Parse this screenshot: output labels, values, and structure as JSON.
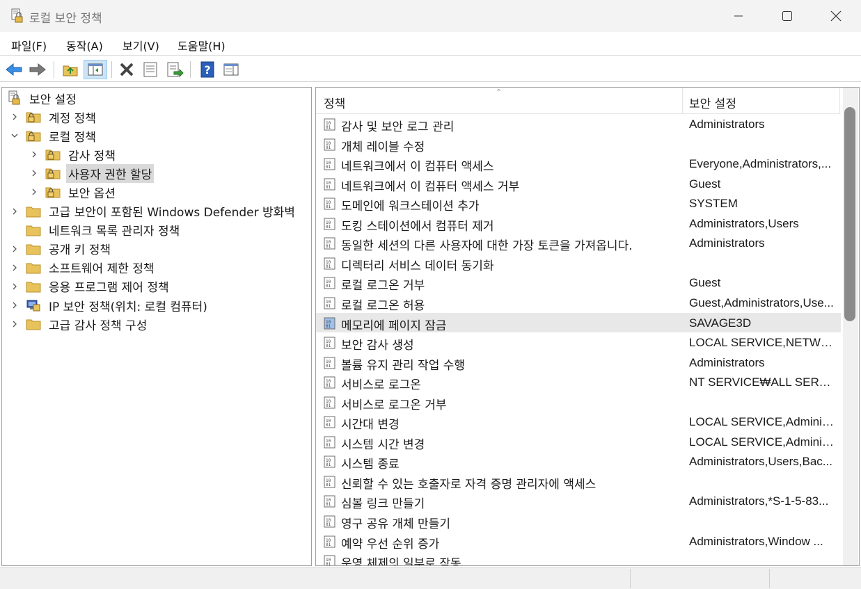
{
  "window": {
    "title": "로컬 보안 정책",
    "icon": "security-policy-icon"
  },
  "menu": {
    "items": [
      "파일(F)",
      "동작(A)",
      "보기(V)",
      "도움말(H)"
    ]
  },
  "toolbar": {
    "buttons": [
      "back-icon",
      "forward-icon",
      "up-folder-icon",
      "show-hide-tree-icon",
      "delete-icon",
      "properties-icon",
      "export-list-icon",
      "help-icon",
      "show-action-pane-icon"
    ]
  },
  "tree": {
    "root": "보안 설정",
    "items": [
      {
        "label": "계정 정책",
        "level": 1,
        "expanded": false
      },
      {
        "label": "로컬 정책",
        "level": 1,
        "expanded": true
      },
      {
        "label": "감사 정책",
        "level": 2,
        "expanded": false
      },
      {
        "label": "사용자 권한 할당",
        "level": 2,
        "expanded": false,
        "selected": true
      },
      {
        "label": "보안 옵션",
        "level": 2,
        "expanded": false
      },
      {
        "label": "고급 보안이 포함된 Windows Defender 방화벽",
        "level": 1,
        "expanded": false
      },
      {
        "label": "네트워크 목록 관리자 정책",
        "level": 1,
        "noexpand": true
      },
      {
        "label": "공개 키 정책",
        "level": 1,
        "expanded": false
      },
      {
        "label": "소프트웨어 제한 정책",
        "level": 1,
        "expanded": false
      },
      {
        "label": "응용 프로그램 제어 정책",
        "level": 1,
        "expanded": false
      },
      {
        "label": "IP 보안 정책(위치: 로컬 컴퓨터)",
        "level": 1,
        "expanded": false,
        "icon": "ip-security-icon"
      },
      {
        "label": "고급 감사 정책 구성",
        "level": 1,
        "expanded": false
      }
    ]
  },
  "list": {
    "columns": [
      "정책",
      "보안 설정"
    ],
    "rows": [
      {
        "policy": "감사 및 보안 로그 관리",
        "setting": "Administrators"
      },
      {
        "policy": "개체 레이블 수정",
        "setting": ""
      },
      {
        "policy": "네트워크에서 이 컴퓨터 액세스",
        "setting": "Everyone,Administrators,..."
      },
      {
        "policy": "네트워크에서 이 컴퓨터 액세스 거부",
        "setting": "Guest"
      },
      {
        "policy": "도메인에 워크스테이션 추가",
        "setting": "SYSTEM"
      },
      {
        "policy": "도킹 스테이션에서 컴퓨터 제거",
        "setting": "Administrators,Users"
      },
      {
        "policy": "동일한 세션의 다른 사용자에 대한 가장 토큰을 가져옵니다.",
        "setting": "Administrators"
      },
      {
        "policy": "디렉터리 서비스 데이터 동기화",
        "setting": ""
      },
      {
        "policy": "로컬 로그온 거부",
        "setting": "Guest"
      },
      {
        "policy": "로컬 로그온 허용",
        "setting": "Guest,Administrators,Use..."
      },
      {
        "policy": "메모리에 페이지 잠금",
        "setting": "SAVAGE3D",
        "selected": true
      },
      {
        "policy": "보안 감사 생성",
        "setting": "LOCAL SERVICE,NETWO..."
      },
      {
        "policy": "볼륨 유지 관리 작업 수행",
        "setting": "Administrators"
      },
      {
        "policy": "서비스로 로그온",
        "setting": "NT SERVICE₩ALL SERVIC..."
      },
      {
        "policy": "서비스로 로그온 거부",
        "setting": ""
      },
      {
        "policy": "시간대 변경",
        "setting": "LOCAL SERVICE,Adminis..."
      },
      {
        "policy": "시스템 시간 변경",
        "setting": "LOCAL SERVICE,Adminis..."
      },
      {
        "policy": "시스템 종료",
        "setting": "Administrators,Users,Bac..."
      },
      {
        "policy": "신뢰할 수 있는 호출자로 자격 증명 관리자에 액세스",
        "setting": ""
      },
      {
        "policy": "심볼 링크 만들기",
        "setting": "Administrators,*S-1-5-83..."
      },
      {
        "policy": "영구 공유 개체 만들기",
        "setting": ""
      },
      {
        "policy": "예약 우선 순위 증가",
        "setting": "Administrators,Window ..."
      },
      {
        "policy": "운영 체제의 일부로 작동",
        "setting": ""
      }
    ]
  },
  "colors": {
    "titlebar": "#f3f3f3",
    "selection": "#d9d9d9",
    "folder": "#e8c25a",
    "accent": "#0078d4"
  }
}
